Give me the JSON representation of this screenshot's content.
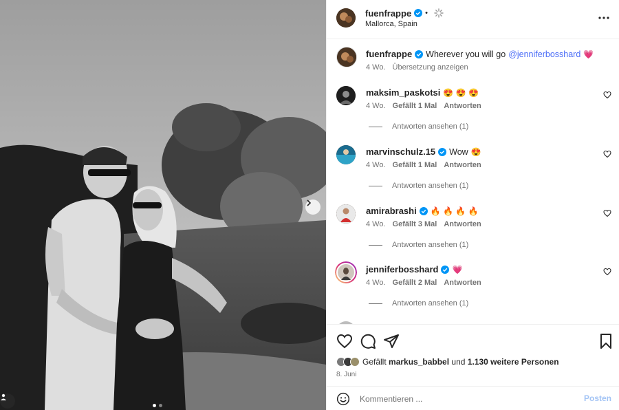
{
  "post": {
    "username": "fuenfrappe",
    "location": "Mallorca, Spain",
    "caption_text": "Wherever you will go",
    "caption_mention": "@jenniferbosshard",
    "caption_emoji": "💗",
    "caption_age": "4 Wo.",
    "translate_label": "Übersetzung anzeigen",
    "icons": {
      "more": "more-horizontal-icon",
      "next": "chevron-right-icon",
      "verified": "verified-badge-icon"
    }
  },
  "comments": [
    {
      "username": "maksim_paskotsi",
      "verified": false,
      "text": "",
      "emoji": "😍 😍 😍",
      "age": "4 Wo.",
      "likes": "Gefällt 1 Mal",
      "reply": "Antworten",
      "view_replies": "Antworten ansehen (1)"
    },
    {
      "username": "marvinschulz.15",
      "verified": true,
      "text": "Wow",
      "emoji": "😍",
      "age": "4 Wo.",
      "likes": "Gefällt 1 Mal",
      "reply": "Antworten",
      "view_replies": "Antworten ansehen (1)"
    },
    {
      "username": "amirabrashi",
      "verified": true,
      "text": "",
      "emoji": "🔥 🔥 🔥 🔥",
      "age": "4 Wo.",
      "likes": "Gefällt 3 Mal",
      "reply": "Antworten",
      "view_replies": "Antworten ansehen (1)"
    },
    {
      "username": "jenniferbosshard",
      "verified": true,
      "text": "",
      "emoji": "💗",
      "age": "4 Wo.",
      "likes": "Gefällt 2 Mal",
      "reply": "Antworten",
      "view_replies": "Antworten ansehen (1)"
    }
  ],
  "actions": {
    "likes_prefix": "Gefällt",
    "likes_user": "markus_babbel",
    "likes_and": "und",
    "likes_others": "1.130 weitere Personen",
    "date": "8. Juni",
    "icons": [
      "heart-icon",
      "comment-icon",
      "share-icon",
      "bookmark-icon"
    ]
  },
  "composer": {
    "placeholder": "Kommentieren ...",
    "post_label": "Posten"
  },
  "carousel": {
    "slides": 2,
    "current": 1
  },
  "colors": {
    "accent": "#0095f6",
    "mention": "#4a6cf7",
    "secondary_text": "#737373",
    "post_button_disabled": "#a3c4f5"
  }
}
